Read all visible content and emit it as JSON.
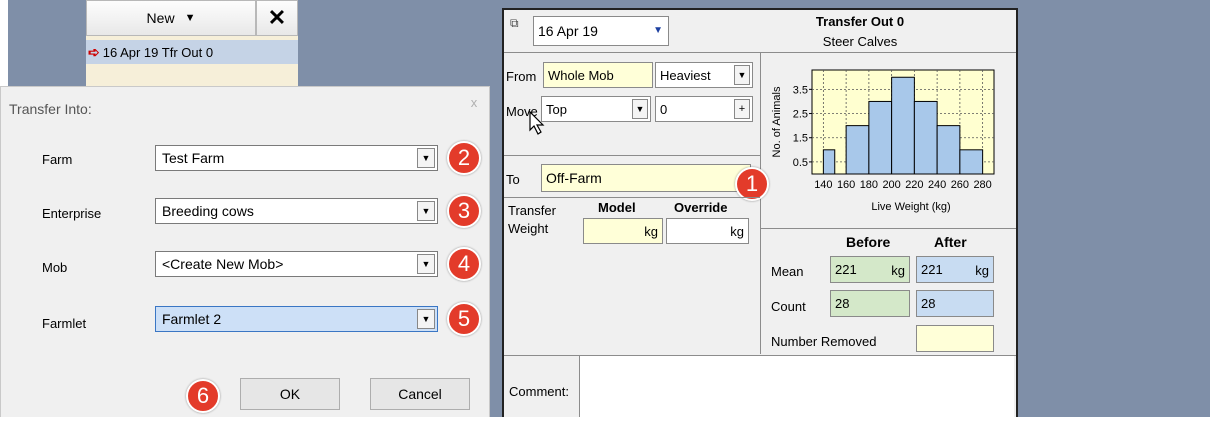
{
  "background_app": {
    "new_label": "New",
    "delete_icon": "close-x-icon",
    "selected_item": "16 Apr 19 Tfr Out 0"
  },
  "dialog": {
    "title": "Transfer Into:",
    "close_glyph": "x",
    "fields": [
      {
        "label": "Farm",
        "value": "Test Farm",
        "badge": "2"
      },
      {
        "label": "Enterprise",
        "value": "Breeding cows",
        "badge": "3"
      },
      {
        "label": "Mob",
        "value": "<Create New Mob>",
        "badge": "4"
      },
      {
        "label": "Farmlet",
        "value": "Farmlet 2",
        "badge": "5"
      }
    ],
    "ok_label": "OK",
    "cancel_label": "Cancel",
    "ok_badge": "6"
  },
  "transfer_panel": {
    "date": "16 Apr 19",
    "title": "Transfer Out 0",
    "subtitle": "Steer Calves",
    "from_label": "From",
    "from_value": "Whole Mob",
    "from_order": "Heaviest",
    "move_label": "Move",
    "move_value": "Top",
    "move_count": "0",
    "plus_label": "+",
    "to_label": "To",
    "to_value": "Off-Farm",
    "to_badge": "1",
    "transfer_weight_label_1": "Transfer",
    "transfer_weight_label_2": "Weight",
    "model_header": "Model",
    "override_header": "Override",
    "model_unit": "kg",
    "override_unit": "kg",
    "before_header": "Before",
    "after_header": "After",
    "mean_label": "Mean",
    "mean_before": "221",
    "mean_before_unit": "kg",
    "mean_after": "221",
    "mean_after_unit": "kg",
    "count_label": "Count",
    "count_before": "28",
    "count_after": "28",
    "removed_label": "Number Removed",
    "comment_label": "Comment:"
  },
  "colors": {
    "backdrop": "#7f8fa8",
    "badge": "#e33b2a",
    "yellow_field": "#ffffd8",
    "green_field": "#d4e8c9",
    "blue_field": "#c8dcf2",
    "histogram_fill": "#a8c8ea",
    "histogram_bg": "#ffffd0"
  },
  "chart_data": {
    "type": "bar",
    "xlabel": "Live Weight (kg)",
    "ylabel": "No. of Animals",
    "x_ticks": [
      "140",
      "160",
      "180",
      "200",
      "220",
      "240",
      "260",
      "280"
    ],
    "y_ticks": [
      "0.5",
      "1.5",
      "2.5",
      "3.5"
    ],
    "ylim": [
      0,
      4.3
    ],
    "xlim": [
      130,
      290
    ],
    "bins": [
      {
        "from": 140,
        "to": 150,
        "value": 1
      },
      {
        "from": 160,
        "to": 180,
        "value": 2
      },
      {
        "from": 180,
        "to": 200,
        "value": 3
      },
      {
        "from": 200,
        "to": 220,
        "value": 4
      },
      {
        "from": 220,
        "to": 240,
        "value": 3
      },
      {
        "from": 240,
        "to": 260,
        "value": 2
      },
      {
        "from": 260,
        "to": 280,
        "value": 1
      }
    ]
  }
}
